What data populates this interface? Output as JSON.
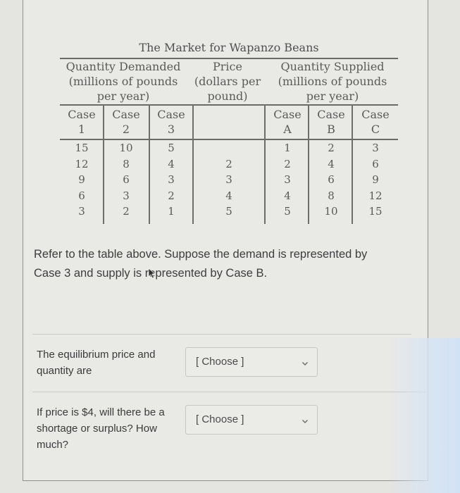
{
  "table": {
    "title": "The Market for Wapanzo Beans",
    "demand_header": [
      "Quantity Demanded",
      "(millions of pounds",
      "per year)"
    ],
    "price_header": [
      "Price",
      "(dollars per",
      "pound)"
    ],
    "supply_header": [
      "Quantity Supplied",
      "(millions of pounds",
      "per year)"
    ],
    "demand_cases": [
      {
        "line1": "Case",
        "line2": "1"
      },
      {
        "line1": "Case",
        "line2": "2"
      },
      {
        "line1": "Case",
        "line2": "3"
      }
    ],
    "supply_cases": [
      {
        "line1": "Case",
        "line2": "A"
      },
      {
        "line1": "Case",
        "line2": "B"
      },
      {
        "line1": "Case",
        "line2": "C"
      }
    ],
    "rows": [
      {
        "d1": "15",
        "d2": "10",
        "d3": "5",
        "price": "",
        "sA": "1",
        "sB": "2",
        "sC": "3"
      },
      {
        "d1": "12",
        "d2": "8",
        "d3": "4",
        "price": "2",
        "sA": "2",
        "sB": "4",
        "sC": "6"
      },
      {
        "d1": "9",
        "d2": "6",
        "d3": "3",
        "price": "3",
        "sA": "3",
        "sB": "6",
        "sC": "9"
      },
      {
        "d1": "6",
        "d2": "3",
        "d3": "2",
        "price": "4",
        "sA": "4",
        "sB": "8",
        "sC": "12"
      },
      {
        "d1": "3",
        "d2": "2",
        "d3": "1",
        "price": "5",
        "sA": "5",
        "sB": "10",
        "sC": "15"
      }
    ]
  },
  "prompt": {
    "line1": "Refer to the table above. Suppose the demand is represented by",
    "line2": "Case 3 and supply is represented by Case B."
  },
  "questions": [
    {
      "label_lines": [
        "The equilibrium price and",
        "quantity are"
      ],
      "select_value": "[ Choose ]",
      "icon": "chevron-down-icon"
    },
    {
      "label_lines": [
        "If price is $4, will there be a",
        "shortage or surplus? How",
        "much?"
      ],
      "select_value": "[ Choose ]",
      "icon": "chevron-down-icon"
    }
  ]
}
